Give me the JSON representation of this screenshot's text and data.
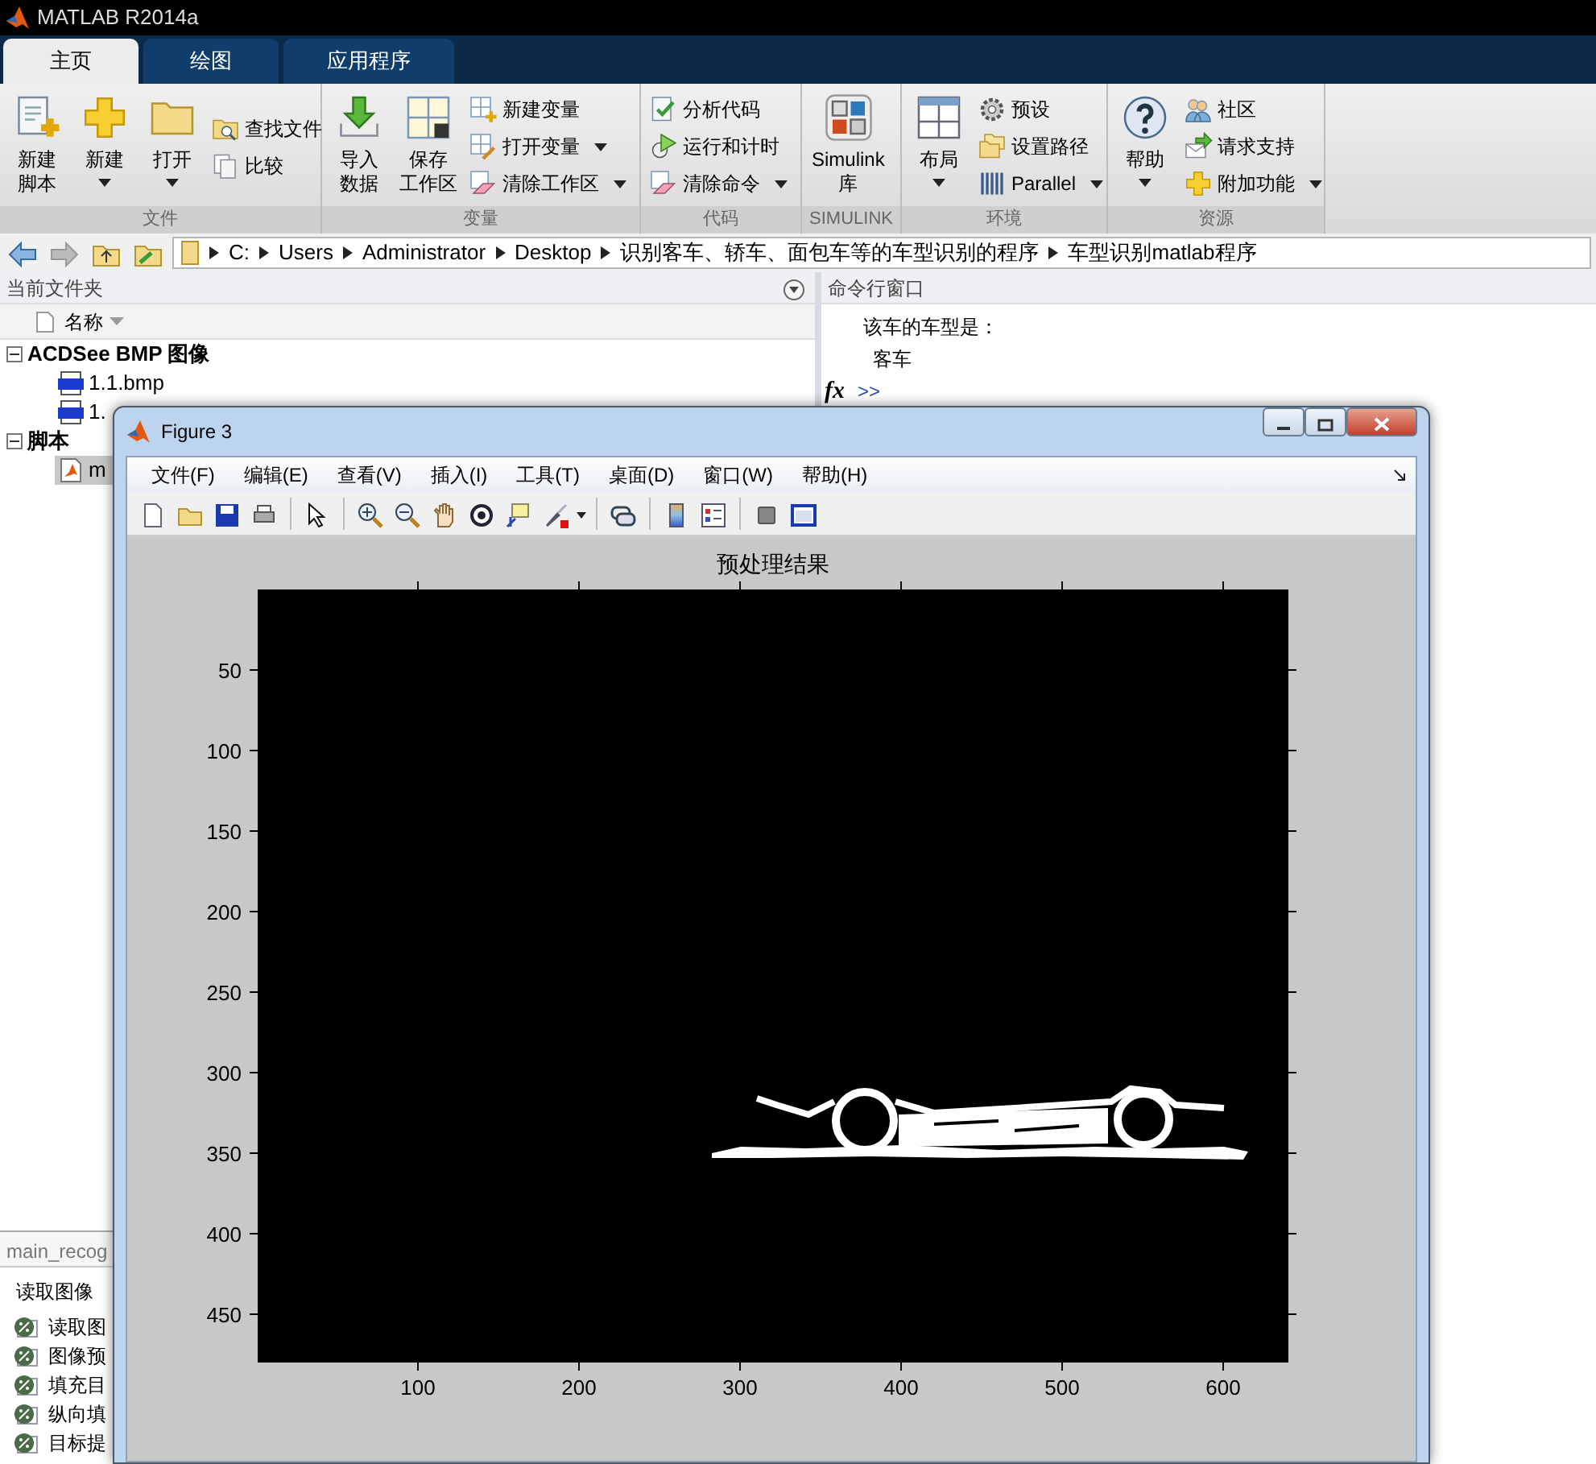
{
  "window": {
    "title": "MATLAB R2014a"
  },
  "tabs": [
    {
      "label": "主页",
      "selected": true
    },
    {
      "label": "绘图",
      "selected": false
    },
    {
      "label": "应用程序",
      "selected": false
    }
  ],
  "ribbon": {
    "groups": [
      {
        "label": "文件",
        "buttons": [
          {
            "kind": "large",
            "lines": [
              "新建",
              "脚本"
            ],
            "dropdown": false
          },
          {
            "kind": "large",
            "lines": [
              "新建"
            ],
            "dropdown": true
          },
          {
            "kind": "large",
            "lines": [
              "打开"
            ],
            "dropdown": true
          },
          {
            "kind": "small",
            "lines": [
              "查找文件"
            ],
            "dropdown": false
          },
          {
            "kind": "small",
            "lines": [
              "比较"
            ],
            "dropdown": false
          }
        ]
      },
      {
        "label": "变量",
        "buttons": [
          {
            "kind": "large",
            "lines": [
              "导入",
              "数据"
            ],
            "dropdown": false
          },
          {
            "kind": "large",
            "lines": [
              "保存",
              "工作区"
            ],
            "dropdown": false
          },
          {
            "kind": "small",
            "lines": [
              "新建变量"
            ],
            "dropdown": false
          },
          {
            "kind": "small",
            "lines": [
              "打开变量"
            ],
            "dropdown": true
          },
          {
            "kind": "small",
            "lines": [
              "清除工作区"
            ],
            "dropdown": true
          }
        ]
      },
      {
        "label": "代码",
        "buttons": [
          {
            "kind": "small",
            "lines": [
              "分析代码"
            ],
            "dropdown": false
          },
          {
            "kind": "small",
            "lines": [
              "运行和计时"
            ],
            "dropdown": false
          },
          {
            "kind": "small",
            "lines": [
              "清除命令"
            ],
            "dropdown": true
          }
        ]
      },
      {
        "label": "SIMULINK",
        "buttons": [
          {
            "kind": "large",
            "lines": [
              "Simulink",
              "库"
            ],
            "dropdown": false
          }
        ]
      },
      {
        "label": "环境",
        "buttons": [
          {
            "kind": "large",
            "lines": [
              "布局"
            ],
            "dropdown": true
          },
          {
            "kind": "small",
            "lines": [
              "预设"
            ],
            "dropdown": false
          },
          {
            "kind": "small",
            "lines": [
              "设置路径"
            ],
            "dropdown": false
          },
          {
            "kind": "small",
            "lines": [
              "Parallel"
            ],
            "dropdown": true
          }
        ]
      },
      {
        "label": "资源",
        "buttons": [
          {
            "kind": "large",
            "lines": [
              "帮助"
            ],
            "dropdown": true
          },
          {
            "kind": "small",
            "lines": [
              "社区"
            ],
            "dropdown": false
          },
          {
            "kind": "small",
            "lines": [
              "请求支持"
            ],
            "dropdown": false
          },
          {
            "kind": "small",
            "lines": [
              "附加功能"
            ],
            "dropdown": true
          }
        ]
      }
    ]
  },
  "address_bar": {
    "segments": [
      "C:",
      "Users",
      "Administrator",
      "Desktop",
      "识别客车、轿车、面包车等的车型识别的程序",
      "车型识别matlab程序"
    ]
  },
  "current_folder": {
    "title": "当前文件夹",
    "column": "名称",
    "groups": [
      {
        "label": "ACDSee BMP 图像",
        "expanded": true,
        "children": [
          {
            "label": "1.1.bmp",
            "kind": "bmp",
            "selected": false
          },
          {
            "label": "1.",
            "kind": "bmp",
            "selected": false
          }
        ]
      },
      {
        "label": "脚本",
        "expanded": true,
        "children": [
          {
            "label": "m",
            "kind": "script",
            "selected": true
          }
        ]
      }
    ]
  },
  "details": {
    "title": "main_recog",
    "heading": "读取图像",
    "sections": [
      "读取图",
      "图像预",
      "填充目",
      "纵向填",
      "目标提"
    ]
  },
  "command_window": {
    "title": "命令行窗口",
    "lines": [
      "该车的车型是：",
      "客车"
    ],
    "function_button": "fx",
    "prompt": ">>"
  },
  "figure": {
    "title": "Figure 3",
    "menu": [
      "文件(F)",
      "编辑(E)",
      "查看(V)",
      "插入(I)",
      "工具(T)",
      "桌面(D)",
      "窗口(W)",
      "帮助(H)"
    ],
    "axes": {
      "title": "预处理结果",
      "yticks": [
        "50",
        "100",
        "150",
        "200",
        "250",
        "300",
        "350",
        "400",
        "450"
      ],
      "xticks": [
        "100",
        "200",
        "300",
        "400",
        "500",
        "600"
      ]
    }
  }
}
